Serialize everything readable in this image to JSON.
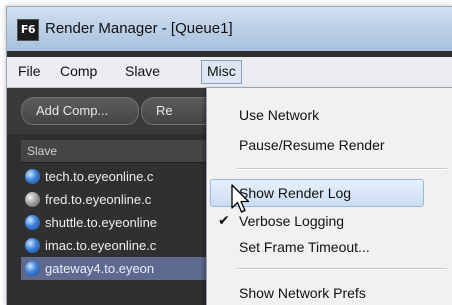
{
  "window": {
    "app_icon_label": "F6",
    "title": "Render Manager - [Queue1]"
  },
  "menubar": {
    "items": [
      {
        "label": "File",
        "open": false
      },
      {
        "label": "Comp",
        "open": false
      },
      {
        "label": "Slave",
        "open": false
      },
      {
        "label": "Misc",
        "open": true
      }
    ]
  },
  "toolbar": {
    "add_comp_label": "Add Comp...",
    "partial_button_label": "Re"
  },
  "slave_list": {
    "header": "Slave",
    "rows": [
      {
        "label": "tech.to.eyeonline.c",
        "status": "blue",
        "selected": false
      },
      {
        "label": "fred.to.eyeonline.c",
        "status": "gray",
        "selected": false
      },
      {
        "label": "shuttle.to.eyeonline",
        "status": "blue",
        "selected": false
      },
      {
        "label": "imac.to.eyeonline.c",
        "status": "blue",
        "selected": false
      },
      {
        "label": "gateway4.to.eyeon",
        "status": "blue",
        "selected": true
      }
    ]
  },
  "misc_menu": {
    "items": [
      {
        "label": "Use Network",
        "checked": false,
        "highlighted": false
      },
      {
        "label": "Pause/Resume Render",
        "checked": false,
        "highlighted": false
      },
      {
        "label": "Show Render Log",
        "checked": false,
        "highlighted": true
      },
      {
        "label": "Verbose Logging",
        "checked": true,
        "highlighted": false
      },
      {
        "label": "Set Frame Timeout...",
        "checked": false,
        "highlighted": false
      },
      {
        "label": "Show Network Prefs",
        "checked": false,
        "highlighted": false
      }
    ],
    "check_glyph": "✔"
  },
  "icons": {
    "app_icon": "fusion-app-icon",
    "cursor": "mouse-pointer-icon"
  }
}
